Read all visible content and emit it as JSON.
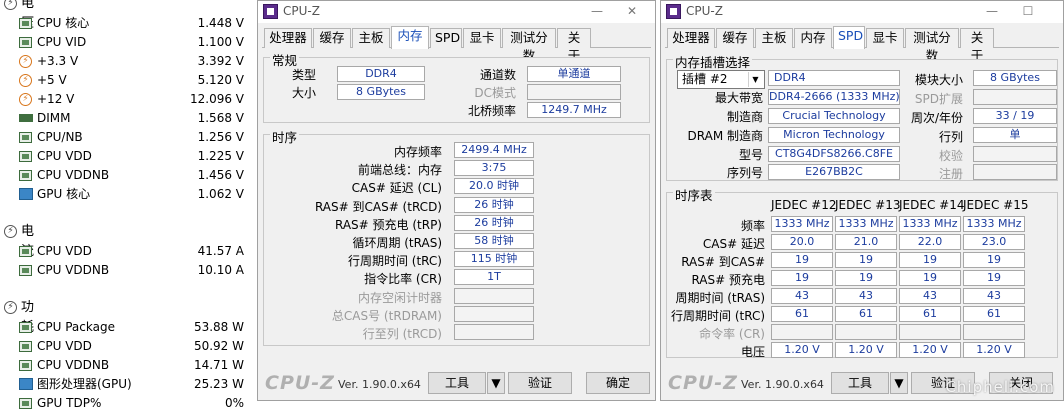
{
  "left": {
    "volt_cat": "电压",
    "volt_rows": [
      {
        "label": "CPU 核心",
        "value": "1.448 V",
        "icon": "sensor-icon"
      },
      {
        "label": "CPU VID",
        "value": "1.100 V",
        "icon": "sensor-icon"
      },
      {
        "label": "+3.3 V",
        "value": "3.392 V",
        "icon": "power-icon"
      },
      {
        "label": "+5 V",
        "value": "5.120 V",
        "icon": "power-icon"
      },
      {
        "label": "+12 V",
        "value": "12.096 V",
        "icon": "power-icon"
      },
      {
        "label": "DIMM",
        "value": "1.568 V",
        "icon": "dimm-icon"
      },
      {
        "label": "CPU/NB",
        "value": "1.256 V",
        "icon": "sensor-icon"
      },
      {
        "label": "CPU VDD",
        "value": "1.225 V",
        "icon": "sensor-icon"
      },
      {
        "label": "CPU VDDNB",
        "value": "1.456 V",
        "icon": "sensor-icon"
      },
      {
        "label": "GPU 核心",
        "value": "1.062 V",
        "icon": "gpu-icon"
      }
    ],
    "curr_cat": "电流",
    "curr_rows": [
      {
        "label": "CPU VDD",
        "value": "41.57 A"
      },
      {
        "label": "CPU VDDNB",
        "value": "10.10 A"
      }
    ],
    "power_cat": "功耗",
    "power_rows": [
      {
        "label": "CPU Package",
        "value": "53.88 W"
      },
      {
        "label": "CPU VDD",
        "value": "50.92 W"
      },
      {
        "label": "CPU VDDNB",
        "value": "14.71 W"
      },
      {
        "label": "图形处理器(GPU)",
        "value": "25.23 W"
      },
      {
        "label": "GPU TDP%",
        "value": "0%"
      }
    ]
  },
  "win1": {
    "title": "CPU-Z",
    "tabs": [
      "处理器",
      "缓存",
      "主板",
      "内存",
      "SPD",
      "显卡",
      "测试分数",
      "关于"
    ],
    "active_tab": "内存",
    "general_title": "常规",
    "type_label": "类型",
    "type_value": "DDR4",
    "size_label": "大小",
    "size_value": "8 GBytes",
    "channel_label": "通道数",
    "channel_value": "单通道",
    "dcmode_label": "DC模式",
    "dcmode_value": "",
    "nb_label": "北桥频率",
    "nb_value": "1249.7 MHz",
    "timing_title": "时序",
    "timings": [
      {
        "label": "内存频率",
        "value": "2499.4 MHz"
      },
      {
        "label": "前端总线：内存",
        "value": "3:75"
      },
      {
        "label": "CAS# 延迟 (CL)",
        "value": "20.0 时钟"
      },
      {
        "label": "RAS# 到CAS# (tRCD)",
        "value": "26 时钟"
      },
      {
        "label": "RAS# 预充电 (tRP)",
        "value": "26 时钟"
      },
      {
        "label": "循环周期 (tRAS)",
        "value": "58 时钟"
      },
      {
        "label": "行周期时间 (tRC)",
        "value": "115 时钟"
      },
      {
        "label": "指令比率 (CR)",
        "value": "1T"
      },
      {
        "label": "内存空闲计时器",
        "value": ""
      },
      {
        "label": "总CAS号 (tRDRAM)",
        "value": ""
      },
      {
        "label": "行至列 (tRCD)",
        "value": ""
      }
    ],
    "brand": "CPU-Z",
    "version": "Ver. 1.90.0.x64",
    "tools_label": "工具",
    "validate_label": "验证",
    "ok_label": "确定"
  },
  "win2": {
    "title": "CPU-Z",
    "tabs": [
      "处理器",
      "缓存",
      "主板",
      "内存",
      "SPD",
      "显卡",
      "测试分数",
      "关于"
    ],
    "active_tab": "SPD",
    "slot_title": "内存插槽选择",
    "slot_value": "插槽 #2",
    "slot_type": "DDR4",
    "module_size_label": "模块大小",
    "module_size_value": "8 GBytes",
    "max_bw_label": "最大带宽",
    "max_bw_value": "DDR4-2666 (1333 MHz)",
    "spd_ext_label": "SPD扩展",
    "spd_ext_value": "",
    "mfr_label": "制造商",
    "mfr_value": "Crucial Technology",
    "week_label": "周次/年份",
    "week_value": "33 / 19",
    "dram_mfr_label": "DRAM 制造商",
    "dram_mfr_value": "Micron Technology",
    "rank_label": "行列",
    "rank_value": "单",
    "part_label": "型号",
    "part_value": "CT8G4DFS8266.C8FE",
    "check_label": "校验",
    "check_value": "",
    "serial_label": "序列号",
    "serial_value": "E267BB2C",
    "reg_label": "注册",
    "reg_value": "",
    "timing_table_title": "时序表",
    "jedec_heads": [
      "JEDEC #12",
      "JEDEC #13",
      "JEDEC #14",
      "JEDEC #15"
    ],
    "jedec_rows": [
      {
        "label": "频率",
        "values": [
          "1333 MHz",
          "1333 MHz",
          "1333 MHz",
          "1333 MHz"
        ]
      },
      {
        "label": "CAS# 延迟",
        "values": [
          "20.0",
          "21.0",
          "22.0",
          "23.0"
        ]
      },
      {
        "label": "RAS# 到CAS#",
        "values": [
          "19",
          "19",
          "19",
          "19"
        ]
      },
      {
        "label": "RAS# 预充电",
        "values": [
          "19",
          "19",
          "19",
          "19"
        ]
      },
      {
        "label": "周期时间 (tRAS)",
        "values": [
          "43",
          "43",
          "43",
          "43"
        ]
      },
      {
        "label": "行周期时间 (tRC)",
        "values": [
          "61",
          "61",
          "61",
          "61"
        ]
      },
      {
        "label": "命令率 (CR)",
        "values": [
          "",
          "",
          "",
          ""
        ]
      },
      {
        "label": "电压",
        "values": [
          "1.20 V",
          "1.20 V",
          "1.20 V",
          "1.20 V"
        ]
      }
    ],
    "brand": "CPU-Z",
    "version": "Ver. 1.90.0.x64",
    "tools_label": "工具",
    "validate_label": "验证",
    "close_label": "关闭",
    "watermark": "Chiphell.com"
  }
}
